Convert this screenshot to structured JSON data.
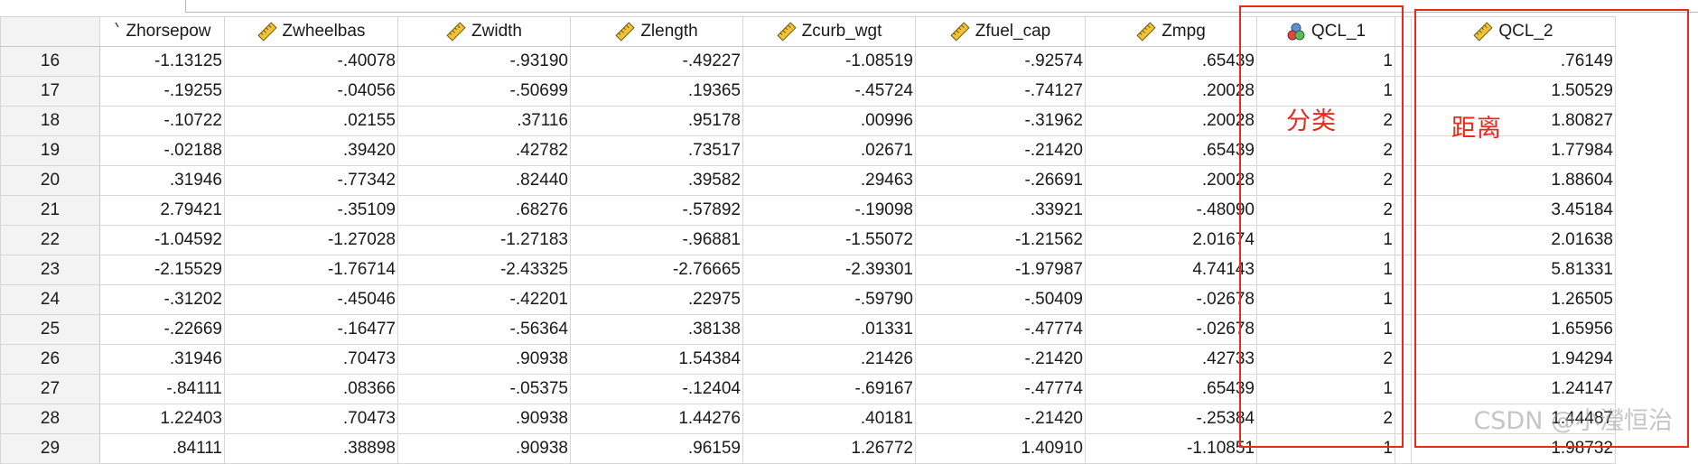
{
  "columns": [
    {
      "name": "Zhorsepow",
      "icon": "marker-icon"
    },
    {
      "name": "Zwheelbas",
      "icon": "ruler-icon"
    },
    {
      "name": "Zwidth",
      "icon": "ruler-icon"
    },
    {
      "name": "Zlength",
      "icon": "ruler-icon"
    },
    {
      "name": "Zcurb_wgt",
      "icon": "ruler-icon"
    },
    {
      "name": "Zfuel_cap",
      "icon": "ruler-icon"
    },
    {
      "name": "Zmpg",
      "icon": "ruler-icon"
    },
    {
      "name": "QCL_1",
      "icon": "cluster-icon"
    },
    {
      "name": "QCL_2",
      "icon": "ruler-icon"
    }
  ],
  "rows": [
    {
      "row": "16",
      "values": [
        "-1.13125",
        "-.40078",
        "-.93190",
        "-.49227",
        "-1.08519",
        "-.92574",
        ".65439",
        "1",
        ".76149"
      ]
    },
    {
      "row": "17",
      "values": [
        "-.19255",
        "-.04056",
        "-.50699",
        ".19365",
        "-.45724",
        "-.74127",
        ".20028",
        "1",
        "1.50529"
      ]
    },
    {
      "row": "18",
      "values": [
        "-.10722",
        ".02155",
        ".37116",
        ".95178",
        ".00996",
        "-.31962",
        ".20028",
        "2",
        "1.80827"
      ]
    },
    {
      "row": "19",
      "values": [
        "-.02188",
        ".39420",
        ".42782",
        ".73517",
        ".02671",
        "-.21420",
        ".65439",
        "2",
        "1.77984"
      ]
    },
    {
      "row": "20",
      "values": [
        ".31946",
        "-.77342",
        ".82440",
        ".39582",
        ".29463",
        "-.26691",
        ".20028",
        "2",
        "1.88604"
      ]
    },
    {
      "row": "21",
      "values": [
        "2.79421",
        "-.35109",
        ".68276",
        "-.57892",
        "-.19098",
        ".33921",
        "-.48090",
        "2",
        "3.45184"
      ]
    },
    {
      "row": "22",
      "values": [
        "-1.04592",
        "-1.27028",
        "-1.27183",
        "-.96881",
        "-1.55072",
        "-1.21562",
        "2.01674",
        "1",
        "2.01638"
      ]
    },
    {
      "row": "23",
      "values": [
        "-2.15529",
        "-1.76714",
        "-2.43325",
        "-2.76665",
        "-2.39301",
        "-1.97987",
        "4.74143",
        "1",
        "5.81331"
      ]
    },
    {
      "row": "24",
      "values": [
        "-.31202",
        "-.45046",
        "-.42201",
        ".22975",
        "-.59790",
        "-.50409",
        "-.02678",
        "1",
        "1.26505"
      ]
    },
    {
      "row": "25",
      "values": [
        "-.22669",
        "-.16477",
        "-.56364",
        ".38138",
        ".01331",
        "-.47774",
        "-.02678",
        "1",
        "1.65956"
      ]
    },
    {
      "row": "26",
      "values": [
        ".31946",
        ".70473",
        ".90938",
        "1.54384",
        ".21426",
        "-.21420",
        ".42733",
        "2",
        "1.94294"
      ]
    },
    {
      "row": "27",
      "values": [
        "-.84111",
        ".08366",
        "-.05375",
        "-.12404",
        "-.69167",
        "-.47774",
        ".65439",
        "1",
        "1.24147"
      ]
    },
    {
      "row": "28",
      "values": [
        "1.22403",
        ".70473",
        ".90938",
        "1.44276",
        ".40181",
        "-.21420",
        "-.25384",
        "2",
        "1.44487"
      ]
    },
    {
      "row": "29",
      "values": [
        ".84111",
        ".38898",
        ".90938",
        ".96159",
        "1.26772",
        "1.40910",
        "-1.10851",
        "1",
        "1.98732"
      ]
    }
  ],
  "annotations": {
    "classification": "分类",
    "distance": "距离"
  },
  "watermark": "CSDN @小瀅恒治",
  "colors": {
    "highlight": "#e8291c"
  }
}
